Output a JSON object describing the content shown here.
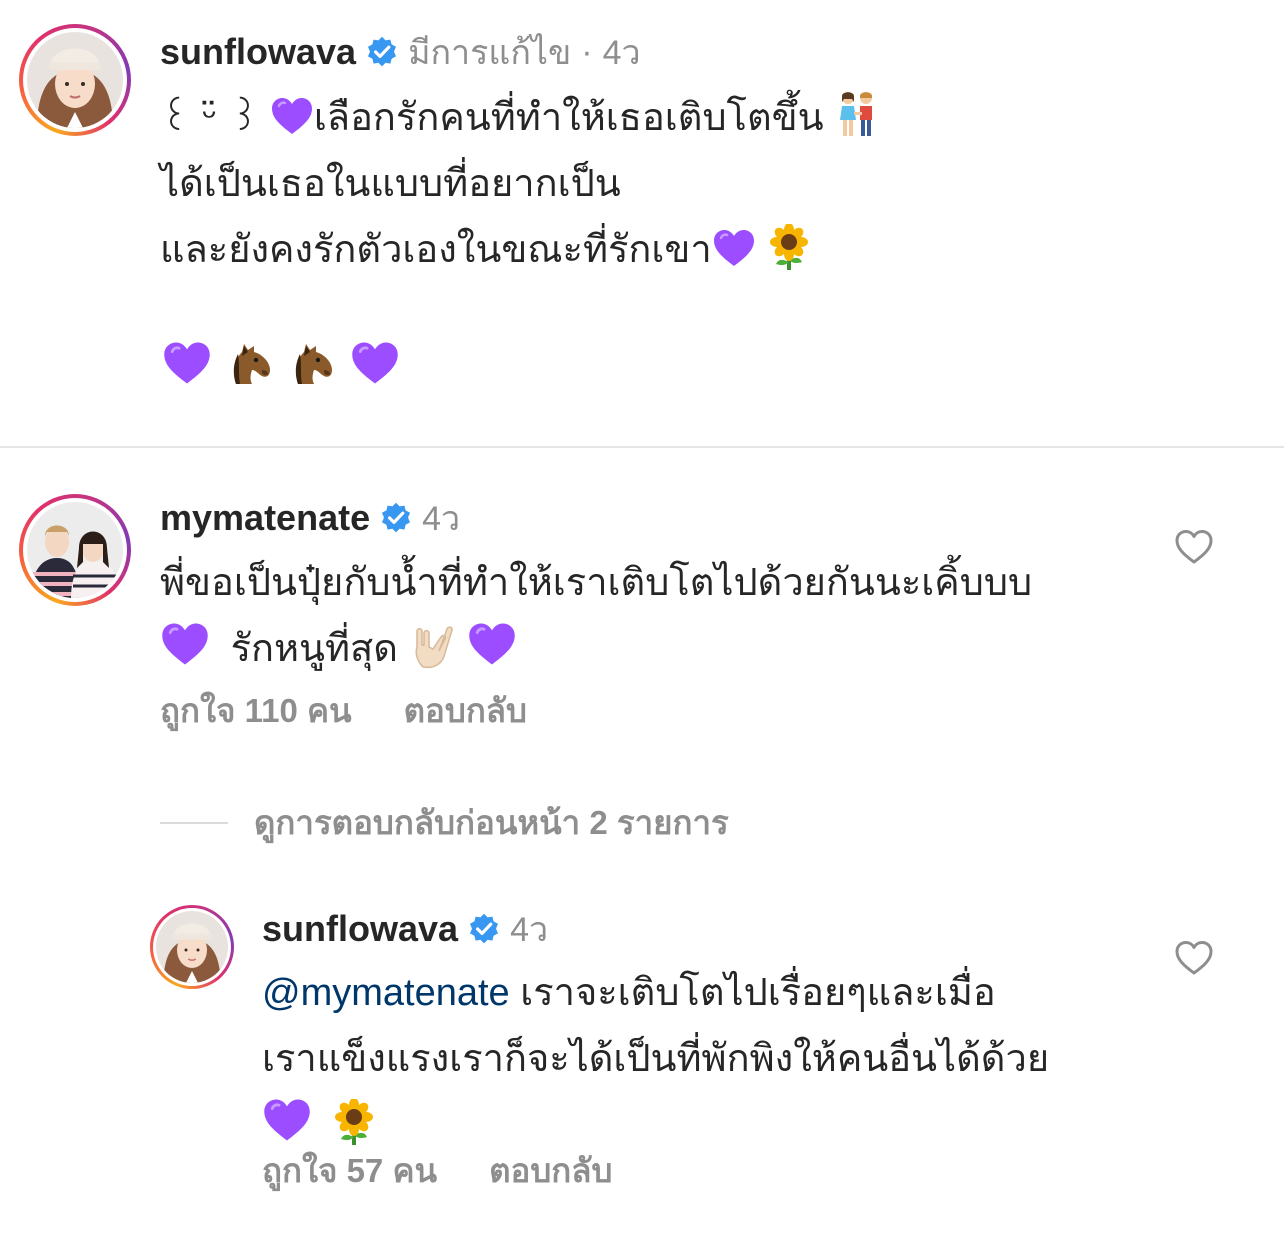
{
  "comment1": {
    "username": "sunflowava",
    "edited_label": "มีการแก้ไข",
    "separator": "·",
    "time": "4ว",
    "line1_prefix": "꒰ ᵕ̈ ꒱",
    "line1_text": "เลือกรักคนที่ทำให้เธอเติบโตขึ้น",
    "line2": "ได้เป็นเธอในแบบที่อยากเป็น",
    "line3": "และยังคงรักตัวเองในขณะที่รักเขา"
  },
  "comment2": {
    "username": "mymatenate",
    "time": "4ว",
    "line1": "พี่ขอเป็นปุ๋ยกับน้ำที่ทำให้เราเติบโตไปด้วยกันนะเคิ้บบบ",
    "line2_text": "รักหนูที่สุด",
    "likes_label": "ถูกใจ 110 คน",
    "reply_label": "ตอบกลับ"
  },
  "view_replies": "ดูการตอบกลับก่อนหน้า 2 รายการ",
  "reply": {
    "username": "sunflowava",
    "time": "4ว",
    "mention": "@mymatenate",
    "line1_text": "เราจะเติบโตไปเรื่อยๆและเมื่อ",
    "line2": "เราแข็งแรงเราก็จะได้เป็นที่พักพิงให้คนอื่นได้ด้วย",
    "likes_label": "ถูกใจ 57 คน",
    "reply_label": "ตอบกลับ"
  },
  "icons": {
    "verified": "verified-badge-icon",
    "heart": "heart-outline-icon",
    "purple_heart": "purple-heart-emoji",
    "sunflower": "sunflower-emoji",
    "horse": "horse-face-emoji",
    "hand": "love-you-gesture-emoji",
    "couple": "couple-holding-hands-emoji"
  },
  "colors": {
    "verified": "#3897f0",
    "muted": "#8e8e8e",
    "mention": "#00376b",
    "purple_heart": "#9b4dff"
  }
}
